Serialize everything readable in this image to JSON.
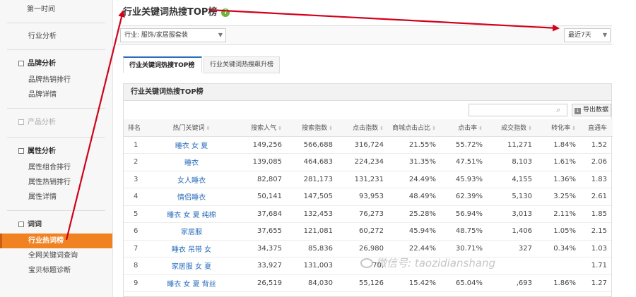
{
  "sidebar": {
    "top_item": "第一时间",
    "industry_analysis": "行业分析",
    "groups": [
      {
        "label": "品牌分析",
        "items": [
          "品牌热销排行",
          "品牌详情"
        ]
      },
      {
        "label": "产品分析",
        "items": []
      },
      {
        "label": "属性分析",
        "items": [
          "属性组合排行",
          "属性热销排行",
          "属性详情"
        ]
      },
      {
        "label": "词词",
        "items": [
          "行业热词榜",
          "全网关键词查询",
          "宝贝标题诊断"
        ]
      }
    ]
  },
  "main": {
    "title": "行业关键词热搜TOP榜",
    "help": "?",
    "filter": {
      "industry": "行业: 服饰/家居服套装",
      "period": "最近7天"
    },
    "tabs": [
      "行业关键词热搜TOP榜",
      "行业关键词热搜飙升榜"
    ],
    "panel_title": "行业关键词热搜TOP榜",
    "export_label": "导出数据",
    "search_value": "",
    "columns": [
      "排名",
      "热门关键词",
      "搜索人气",
      "搜索指数",
      "点击指数",
      "商城点击占比",
      "点击率",
      "成交指数",
      "转化率",
      "直通车"
    ],
    "rows": [
      [
        "1",
        "睡衣 女 夏",
        "149,256",
        "566,688",
        "316,724",
        "21.55%",
        "55.72%",
        "11,271",
        "1.84%",
        "1.52"
      ],
      [
        "2",
        "睡衣",
        "139,085",
        "464,683",
        "224,234",
        "31.35%",
        "47.51%",
        "8,103",
        "1.61%",
        "2.06"
      ],
      [
        "3",
        "女人睡衣",
        "82,807",
        "281,173",
        "131,231",
        "24.49%",
        "45.93%",
        "4,155",
        "1.36%",
        "1.83"
      ],
      [
        "4",
        "情侣睡衣",
        "50,141",
        "147,505",
        "93,953",
        "48.49%",
        "62.39%",
        "5,130",
        "3.25%",
        "2.61"
      ],
      [
        "5",
        "睡衣 女 夏 纯棉",
        "37,684",
        "132,453",
        "76,273",
        "25.28%",
        "56.94%",
        "3,013",
        "2.11%",
        "1.85"
      ],
      [
        "6",
        "家居服",
        "37,655",
        "121,081",
        "60,272",
        "45.94%",
        "48.75%",
        "1,406",
        "1.05%",
        "2.15"
      ],
      [
        "7",
        "睡衣 吊带 女",
        "34,375",
        "85,836",
        "26,980",
        "22.44%",
        "30.71%",
        "327",
        "0.34%",
        "1.03"
      ],
      [
        "8",
        "家居服 女 夏",
        "33,927",
        "131,003",
        "70,",
        "",
        "",
        "",
        "",
        "1.71"
      ],
      [
        "9",
        "睡衣 女 夏 背丝",
        "26,519",
        "84,030",
        "55,126",
        "15.42%",
        "65.04%",
        ",693",
        "1.86%",
        "1.27"
      ]
    ]
  },
  "watermark": "微信号: taozidianshang",
  "annotation_color": "#d0021b"
}
